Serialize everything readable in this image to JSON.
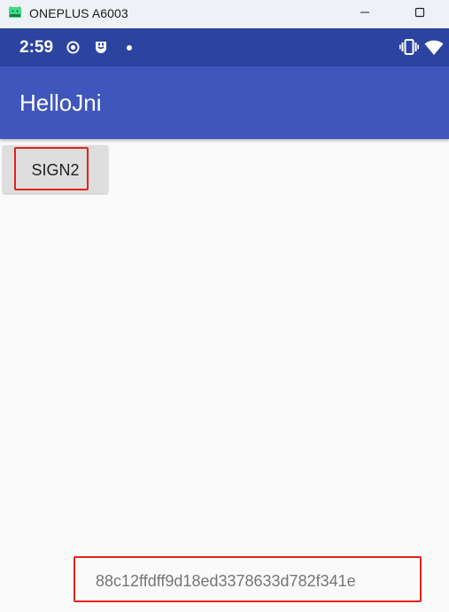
{
  "window": {
    "title": "ONEPLUS A6003",
    "icon": "android-device-icon",
    "controls": [
      "minimize-icon",
      "maximize-icon"
    ]
  },
  "status_bar": {
    "time": "2:59",
    "left_icons": [
      "target-icon",
      "notification-app-icon",
      "dot-icon"
    ],
    "right_icons": [
      "vibrate-icon",
      "wifi-icon"
    ],
    "background": "#2c43a0"
  },
  "app_bar": {
    "title": "HelloJni",
    "background": "#3f56bc"
  },
  "main": {
    "sign_button_label": "SIGN2",
    "result_text": "88c12ffdff9d18ed3378633d782f341e"
  },
  "colors": {
    "highlight": "#e2231a",
    "page_background": "#fafafa"
  }
}
